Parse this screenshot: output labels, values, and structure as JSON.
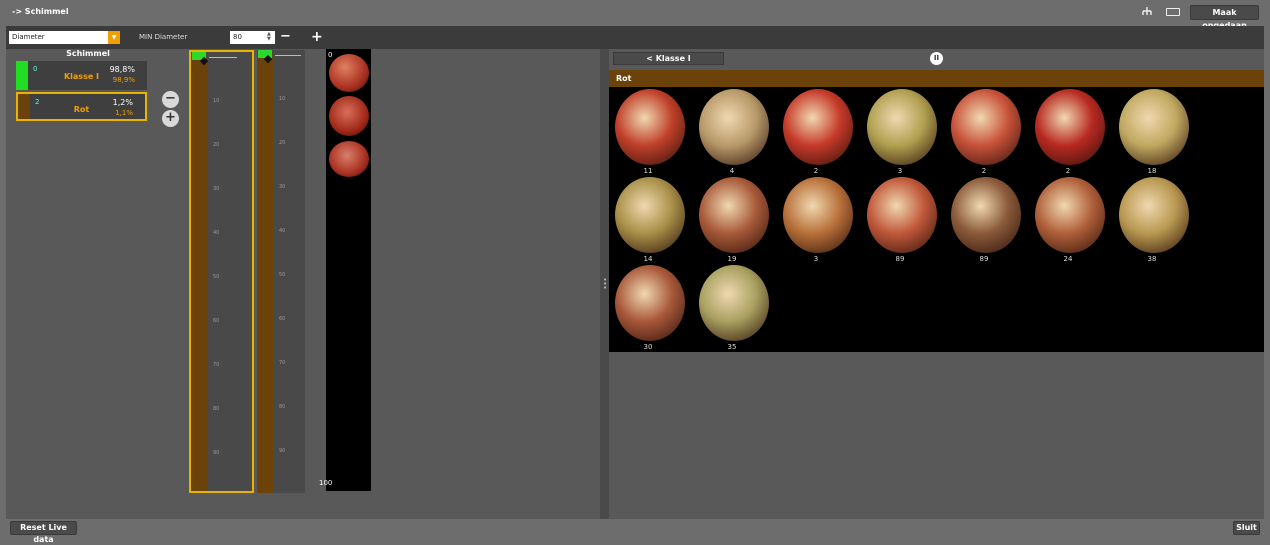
{
  "header": {
    "breadcrumb": "-> Schimmel",
    "undo_label": "Maak ongedaan",
    "icons": [
      "tree-icon",
      "keyboard-icon"
    ]
  },
  "toolbar": {
    "select_value": "Diameter",
    "min_label": "MIN Diameter",
    "min_value": "80",
    "minus": "−",
    "plus": "+"
  },
  "classes_panel": {
    "title": "Schimmel",
    "items": [
      {
        "num": "0",
        "name": "Klasse I",
        "pct1": "98,8%",
        "pct2": "98,9%",
        "color": "#22dd22"
      },
      {
        "num": "2",
        "name": "Rot",
        "pct1": "1,2%",
        "pct2": "1,1%",
        "color": "#6b420a"
      }
    ],
    "zoom_minus": "−",
    "zoom_plus": "+"
  },
  "sliders": {
    "ticks": [
      "10",
      "20",
      "30",
      "40",
      "50",
      "60",
      "70",
      "80",
      "90"
    ],
    "top_label": "0",
    "bottom_label": "100"
  },
  "right": {
    "back_button": "< Klasse I",
    "section_title": "Rot",
    "pause_icon": "pause-icon",
    "items": [
      {
        "count": "11",
        "color": "#c0402a"
      },
      {
        "count": "4",
        "color": "#b89a6a"
      },
      {
        "count": "2",
        "color": "#c63a2a"
      },
      {
        "count": "3",
        "color": "#b0a050"
      },
      {
        "count": "2",
        "color": "#c8523a"
      },
      {
        "count": "2",
        "color": "#b82a22"
      },
      {
        "count": "18",
        "color": "#c0a860"
      },
      {
        "count": "14",
        "color": "#a89048"
      },
      {
        "count": "19",
        "color": "#a85a3a"
      },
      {
        "count": "3",
        "color": "#b8703a"
      },
      {
        "count": "89",
        "color": "#c0583a"
      },
      {
        "count": "89",
        "color": "#8a5a3a"
      },
      {
        "count": "24",
        "color": "#b0603a"
      },
      {
        "count": "38",
        "color": "#b89850"
      },
      {
        "count": "30",
        "color": "#a8583a"
      },
      {
        "count": "35",
        "color": "#a8a060"
      }
    ]
  },
  "footer": {
    "reset_label": "Reset Live data",
    "close_label": "Sluit"
  }
}
